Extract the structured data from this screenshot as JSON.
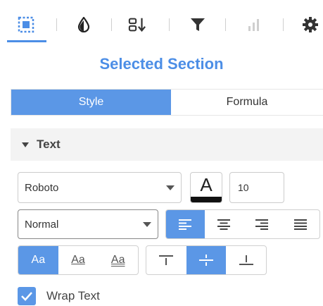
{
  "toolbar": {
    "icons": [
      "selection-icon",
      "fill-drop-icon",
      "sort-icon",
      "filter-icon",
      "bar-chart-icon",
      "gear-icon"
    ],
    "accent_color": "#4c8ee6"
  },
  "panel_title": "Selected Section",
  "tabs": [
    {
      "label": "Style",
      "active": true
    },
    {
      "label": "Formula",
      "active": false
    }
  ],
  "section": {
    "label": "Text"
  },
  "text": {
    "font_family": "Roboto",
    "color_label": "A",
    "font_color": "#111111",
    "font_size": "10",
    "font_weight": "Normal",
    "alignment": [
      "left",
      "center",
      "right",
      "justify"
    ],
    "alignment_selected": "left",
    "case_options": [
      {
        "label": "Aa",
        "style": "plain",
        "active": true
      },
      {
        "label": "Aa",
        "style": "underline",
        "active": false
      },
      {
        "label": "Aa",
        "style": "double-underline",
        "active": false
      }
    ],
    "vertical_alignment": [
      "top",
      "middle",
      "bottom"
    ],
    "vertical_alignment_selected": "middle",
    "wrap_text": {
      "label": "Wrap Text",
      "checked": true
    }
  }
}
